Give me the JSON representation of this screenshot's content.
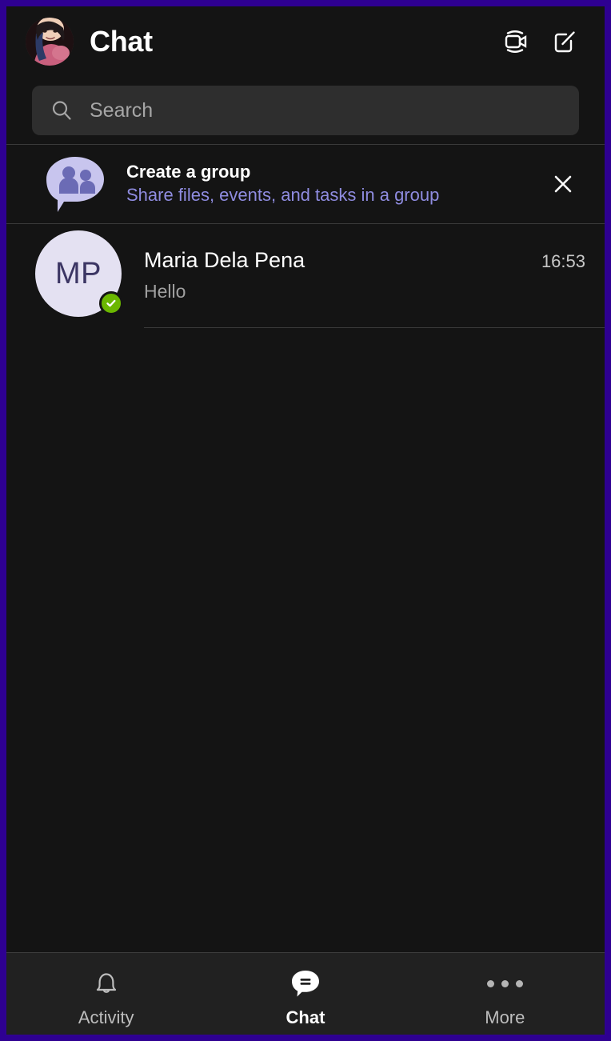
{
  "window": {
    "border_color": "#2e0091",
    "background": "#141414"
  },
  "header": {
    "title": "Chat",
    "avatar": {
      "icon": "user-profile-photo",
      "alt": "profile photo"
    },
    "actions": [
      {
        "name": "meet-now-icon",
        "label": "Meet now"
      },
      {
        "name": "new-chat-icon",
        "label": "New chat"
      }
    ]
  },
  "search": {
    "icon": "search-icon",
    "placeholder": "Search",
    "value": ""
  },
  "banner": {
    "icon": "create-group-icon",
    "title": "Create a group",
    "subtitle": "Share files, events, and tasks in a group",
    "close_icon": "close-icon",
    "accent_color": "#8f8ce0"
  },
  "chat_list": [
    {
      "initials": "MP",
      "name": "Maria Dela Pena",
      "preview": "Hello",
      "time": "16:53",
      "presence": "available",
      "presence_color": "#6bb700"
    }
  ],
  "bottom_nav": {
    "items": [
      {
        "icon": "bell-icon",
        "label": "Activity",
        "active": false
      },
      {
        "icon": "chat-bubble-icon",
        "label": "Chat",
        "active": true
      },
      {
        "icon": "more-dots-icon",
        "label": "More",
        "active": false
      }
    ]
  }
}
